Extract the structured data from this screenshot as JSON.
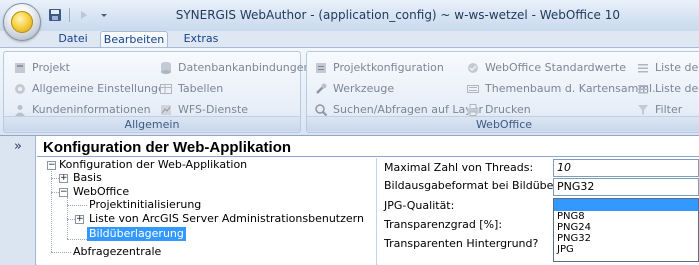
{
  "window": {
    "title": "SYNERGIS WebAuthor - (application_config) ~ w-ws-wetzel - WebOffice 10"
  },
  "icons": {
    "orb": "office-orb-icon",
    "save": "save-icon",
    "forward": "forward-icon",
    "customize": "customize-qat-icon"
  },
  "tabs": [
    {
      "label": "Datei"
    },
    {
      "label": "Bearbeiten"
    },
    {
      "label": "Extras"
    }
  ],
  "ribbon": {
    "groups": [
      {
        "label": "Allgemein",
        "items": [
          {
            "label": "Projekt",
            "icon": "project-icon"
          },
          {
            "label": "Allgemeine Einstellungen",
            "icon": "settings-icon"
          },
          {
            "label": "Kundeninformationen",
            "icon": "customer-info-icon"
          },
          {
            "label": "Datenbankanbindungen",
            "icon": "database-icon"
          },
          {
            "label": "Tabellen",
            "icon": "table-icon"
          },
          {
            "label": "WFS-Dienste",
            "icon": "wfs-service-icon"
          }
        ]
      },
      {
        "label": "WebOffice",
        "items": [
          {
            "label": "Projektkonfiguration",
            "icon": "project-config-icon"
          },
          {
            "label": "Werkzeuge",
            "icon": "tools-icon"
          },
          {
            "label": "Suchen/Abfragen auf Layer",
            "icon": "search-layer-icon"
          },
          {
            "label": "WebOffice Standardwerte",
            "icon": "defaults-icon"
          },
          {
            "label": "Themenbaum d. Kartensamml.",
            "icon": "theme-tree-icon"
          },
          {
            "label": "Drucken",
            "icon": "print-icon"
          },
          {
            "label": "Liste der",
            "icon": "list-icon"
          },
          {
            "label": "Liste de",
            "icon": "list-icon"
          },
          {
            "label": "Filter",
            "icon": "filter-icon"
          }
        ]
      }
    ]
  },
  "main": {
    "collapse_label": "»",
    "title": "Konfiguration der Web-Applikation",
    "tree": {
      "root": "Konfiguration der Web-Applikation",
      "basis": "Basis",
      "weboffice": "WebOffice",
      "projektinit": "Projektinitialisierung",
      "arcgis_admins": "Liste von ArcGIS Server Administrationsbenutzern",
      "bilduberlagerung": "Bildüberlagerung",
      "abfragezentrale": "Abfragezentrale",
      "expand_plus": "+",
      "expand_minus": "−"
    },
    "properties": {
      "threads_label": "Maximal Zahl von Threads:",
      "threads_value": "10",
      "format_label": "Bildausgabeformat bei Bildüberlagerung:",
      "format_value": "PNG32",
      "jpg_label": "JPG-Qualität:",
      "transparency_label": "Transparenzgrad [%]:",
      "transparent_bg_label": "Transparenten Hintergrund?",
      "format_options": [
        "",
        "PNG8",
        "PNG24",
        "PNG32",
        "JPG"
      ]
    }
  },
  "colors": {
    "accent": "#3399ff",
    "ribbon_bg": "#e4ecf7",
    "title_text": "#1e395b"
  }
}
